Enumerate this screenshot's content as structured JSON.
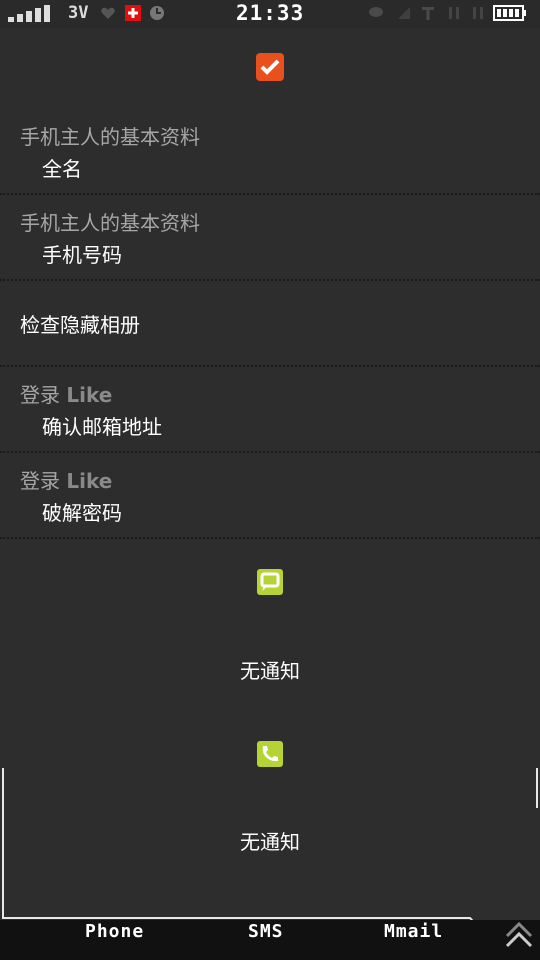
{
  "status_bar": {
    "network": "3V",
    "time": "21:33"
  },
  "list": [
    {
      "title": "手机主人的基本资料",
      "subtitle": "全名"
    },
    {
      "title": "手机主人的基本资料",
      "subtitle": "手机号码"
    },
    {
      "single": "检查隐藏相册"
    },
    {
      "title_prefix": "登录",
      "title_brand": "Like",
      "subtitle": "确认邮箱地址"
    },
    {
      "title_prefix": "登录",
      "title_brand": "Like",
      "subtitle": "破解密码"
    }
  ],
  "notifications": [
    {
      "icon": "message-icon",
      "text": "无通知"
    },
    {
      "icon": "phone-icon",
      "text": "无通知"
    }
  ],
  "tabs": [
    {
      "label": "Phone"
    },
    {
      "label": "SMS"
    },
    {
      "label": "Mmail"
    }
  ],
  "colors": {
    "accent_orange": "#e8501e",
    "notif_green": "#b5d334",
    "background": "#2d2d2d",
    "tabbar": "#111111"
  }
}
